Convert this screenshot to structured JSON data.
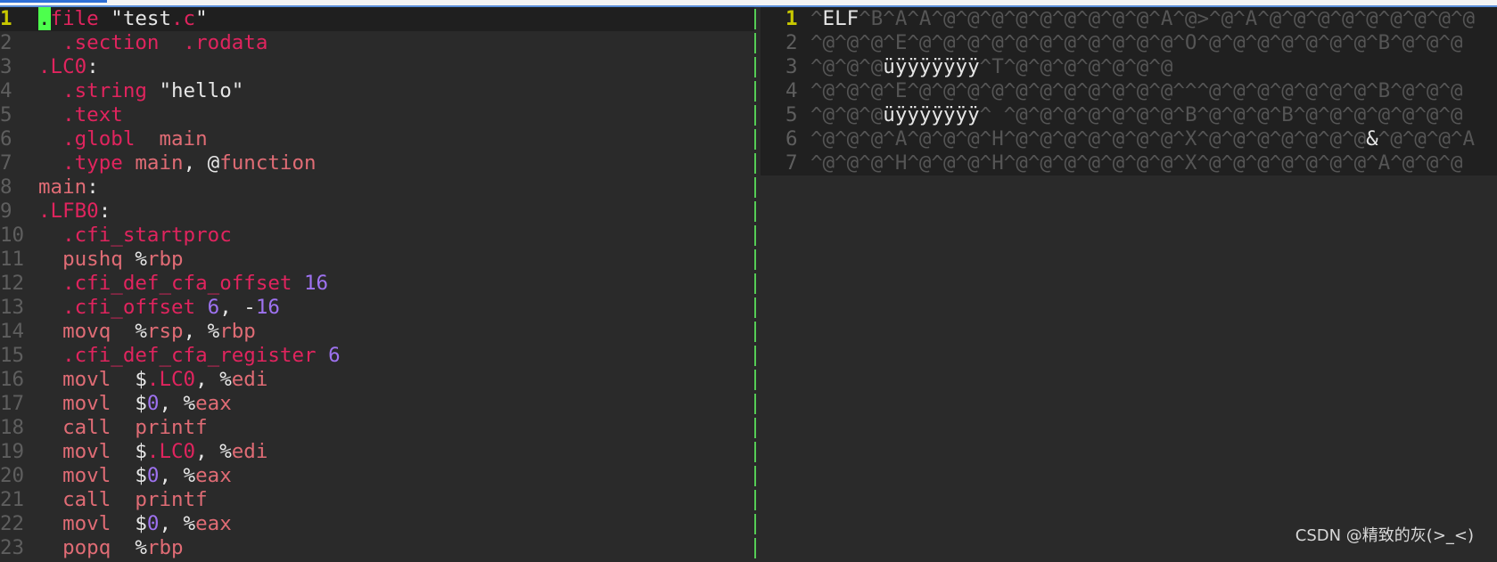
{
  "left": {
    "lines": [
      {
        "n": "1",
        "current": true,
        "segs": [
          [
            "cursor",
            "."
          ],
          [
            "k",
            "file "
          ],
          [
            "s",
            "\"test"
          ],
          [
            "k",
            ".c"
          ],
          [
            "s",
            "\""
          ]
        ]
      },
      {
        "n": "2",
        "segs": [
          [
            "k",
            "  .section  .rodata"
          ]
        ]
      },
      {
        "n": "3",
        "segs": [
          [
            "k",
            ".LC0"
          ],
          [
            "s",
            ":"
          ]
        ]
      },
      {
        "n": "4",
        "segs": [
          [
            "k",
            "  .string "
          ],
          [
            "s",
            "\"hello\""
          ]
        ]
      },
      {
        "n": "5",
        "segs": [
          [
            "k",
            "  .text"
          ]
        ]
      },
      {
        "n": "6",
        "segs": [
          [
            "k",
            "  .globl  "
          ],
          [
            "m",
            "main"
          ]
        ]
      },
      {
        "n": "7",
        "segs": [
          [
            "k",
            "  .type "
          ],
          [
            "m",
            "main"
          ],
          [
            "s",
            ", "
          ],
          [
            "s",
            "@"
          ],
          [
            "m",
            "function"
          ]
        ]
      },
      {
        "n": "8",
        "segs": [
          [
            "m",
            "main"
          ],
          [
            "s",
            ":"
          ]
        ]
      },
      {
        "n": "9",
        "segs": [
          [
            "k",
            ".LFB0"
          ],
          [
            "s",
            ":"
          ]
        ]
      },
      {
        "n": "10",
        "segs": [
          [
            "k",
            "  .cfi_startproc"
          ]
        ]
      },
      {
        "n": "11",
        "segs": [
          [
            "m",
            "  pushq "
          ],
          [
            "s",
            "%"
          ],
          [
            "m",
            "rbp"
          ]
        ]
      },
      {
        "n": "12",
        "segs": [
          [
            "k",
            "  .cfi_def_cfa_offset "
          ],
          [
            "n",
            "16"
          ]
        ]
      },
      {
        "n": "13",
        "segs": [
          [
            "k",
            "  .cfi_offset "
          ],
          [
            "n",
            "6"
          ],
          [
            "s",
            ", -"
          ],
          [
            "n",
            "16"
          ]
        ]
      },
      {
        "n": "14",
        "segs": [
          [
            "m",
            "  movq  "
          ],
          [
            "s",
            "%"
          ],
          [
            "m",
            "rsp"
          ],
          [
            "s",
            ", %"
          ],
          [
            "m",
            "rbp"
          ]
        ]
      },
      {
        "n": "15",
        "segs": [
          [
            "k",
            "  .cfi_def_cfa_register "
          ],
          [
            "n",
            "6"
          ]
        ]
      },
      {
        "n": "16",
        "segs": [
          [
            "m",
            "  movl  "
          ],
          [
            "s",
            "$"
          ],
          [
            "k",
            ".LC0"
          ],
          [
            "s",
            ", %"
          ],
          [
            "m",
            "edi"
          ]
        ]
      },
      {
        "n": "17",
        "segs": [
          [
            "m",
            "  movl  "
          ],
          [
            "s",
            "$"
          ],
          [
            "n",
            "0"
          ],
          [
            "s",
            ", %"
          ],
          [
            "m",
            "eax"
          ]
        ]
      },
      {
        "n": "18",
        "segs": [
          [
            "m",
            "  call  printf"
          ]
        ]
      },
      {
        "n": "19",
        "segs": [
          [
            "m",
            "  movl  "
          ],
          [
            "s",
            "$"
          ],
          [
            "k",
            ".LC0"
          ],
          [
            "s",
            ", %"
          ],
          [
            "m",
            "edi"
          ]
        ]
      },
      {
        "n": "20",
        "segs": [
          [
            "m",
            "  movl  "
          ],
          [
            "s",
            "$"
          ],
          [
            "n",
            "0"
          ],
          [
            "s",
            ", %"
          ],
          [
            "m",
            "eax"
          ]
        ]
      },
      {
        "n": "21",
        "segs": [
          [
            "m",
            "  call  printf"
          ]
        ]
      },
      {
        "n": "22",
        "segs": [
          [
            "m",
            "  movl  "
          ],
          [
            "s",
            "$"
          ],
          [
            "n",
            "0"
          ],
          [
            "s",
            ", %"
          ],
          [
            "m",
            "eax"
          ]
        ]
      },
      {
        "n": "23",
        "segs": [
          [
            "m",
            "  popq  "
          ],
          [
            "s",
            "%"
          ],
          [
            "m",
            "rbp"
          ]
        ]
      }
    ]
  },
  "right": {
    "lines": [
      {
        "n": "1",
        "current": true,
        "segs": [
          [
            "dim",
            "^"
          ],
          [
            "t",
            "ELF"
          ],
          [
            "dim",
            "^B^A^A^@^@^@^@^@^@^@^@^@^A^@>^@^A^@^@^@^@^@^@^@^@^@"
          ]
        ]
      },
      {
        "n": "2",
        "segs": [
          [
            "dim",
            "^@^@^@^E^@^@^@^@^@^@^@^@^@^@^@^O^@^@^@^@^@^@^@^B^@^@^@"
          ]
        ]
      },
      {
        "n": "3",
        "segs": [
          [
            "dim",
            "^@^@^@"
          ],
          [
            "t",
            "üÿÿÿÿÿÿÿ"
          ],
          [
            "dim",
            "^T^@^@^@^@^@^@^@"
          ]
        ]
      },
      {
        "n": "4",
        "segs": [
          [
            "dim",
            "^@^@^@^E^@^@^@^@^@^@^@^@^@^@^@^^^@^@^@^@^@^@^@^B^@^@^@"
          ]
        ]
      },
      {
        "n": "5",
        "segs": [
          [
            "dim",
            "^@^@^@"
          ],
          [
            "t",
            "üÿÿÿÿÿÿÿ"
          ],
          [
            "dim",
            "^ ^@^@^@^@^@^@^@^B^@^@^@^B^@^@^@^@^@^@^@"
          ]
        ]
      },
      {
        "n": "6",
        "segs": [
          [
            "dim",
            "^@^@^@^A^@^@^@^H^@^@^@^@^@^@^@^X^@^@^@^@^@^@^@"
          ],
          [
            "t",
            "&"
          ],
          [
            "dim",
            "^@^@^@^A"
          ]
        ]
      },
      {
        "n": "7",
        "segs": [
          [
            "dim",
            "^@^@^@^H^@^@^@^H^@^@^@^@^@^@^@^X^@^@^@^@^@^@^@^A^@^@^@"
          ]
        ]
      }
    ]
  },
  "watermark": "CSDN @精致的灰(>_<)"
}
